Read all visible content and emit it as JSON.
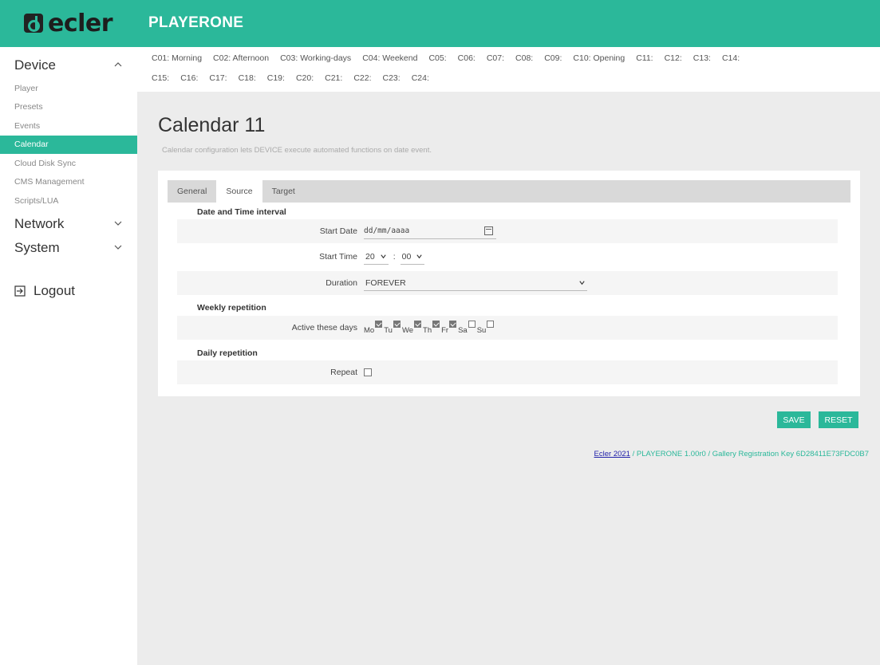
{
  "brand": {
    "logo_text": "ecler",
    "product": "PLAYERONE"
  },
  "sidebar": {
    "device_label": "Device",
    "items": [
      {
        "label": "Player"
      },
      {
        "label": "Presets"
      },
      {
        "label": "Events"
      },
      {
        "label": "Calendar",
        "active": true
      },
      {
        "label": "Cloud Disk Sync"
      },
      {
        "label": "CMS Management"
      },
      {
        "label": "Scripts/LUA"
      }
    ],
    "network_label": "Network",
    "system_label": "System",
    "logout_label": "Logout"
  },
  "calendars": {
    "row1": [
      "C01: Morning",
      "C02: Afternoon",
      "C03: Working-days",
      "C04: Weekend",
      "C05:",
      "C06:",
      "C07:",
      "C08:",
      "C09:",
      "C10: Opening",
      "C11:",
      "C12:",
      "C13:",
      "C14:"
    ],
    "row2": [
      "C15:",
      "C16:",
      "C17:",
      "C18:",
      "C19:",
      "C20:",
      "C21:",
      "C22:",
      "C23:",
      "C24:"
    ]
  },
  "page": {
    "title": "Calendar 11",
    "description": "Calendar configuration lets DEVICE execute automated functions on date event."
  },
  "tabs": [
    "General",
    "Source",
    "Target"
  ],
  "active_tab": "Source",
  "form": {
    "date_time_title": "Date and Time interval",
    "start_date_label": "Start Date",
    "start_date_value": "dd/mm/aaaa",
    "start_time_label": "Start Time",
    "start_hour": "20",
    "start_minute": "00",
    "duration_label": "Duration",
    "duration_value": "FOREVER",
    "weekly_title": "Weekly repetition",
    "active_days_label": "Active these days",
    "days": [
      {
        "label": "Mo",
        "checked": true
      },
      {
        "label": "Tu",
        "checked": true
      },
      {
        "label": "We",
        "checked": true
      },
      {
        "label": "Th",
        "checked": true
      },
      {
        "label": "Fr",
        "checked": true
      },
      {
        "label": "Sa",
        "checked": false
      },
      {
        "label": "Su",
        "checked": false
      }
    ],
    "daily_title": "Daily repetition",
    "repeat_label": "Repeat"
  },
  "buttons": {
    "save": "SAVE",
    "reset": "RESET"
  },
  "footer": {
    "link": "Ecler 2021",
    "text": " / PLAYERONE 1.00r0 / Gallery Registration Key 6D28411E73FDC0B7"
  },
  "colors": {
    "accent": "#2bb89a",
    "background": "#ececec"
  }
}
